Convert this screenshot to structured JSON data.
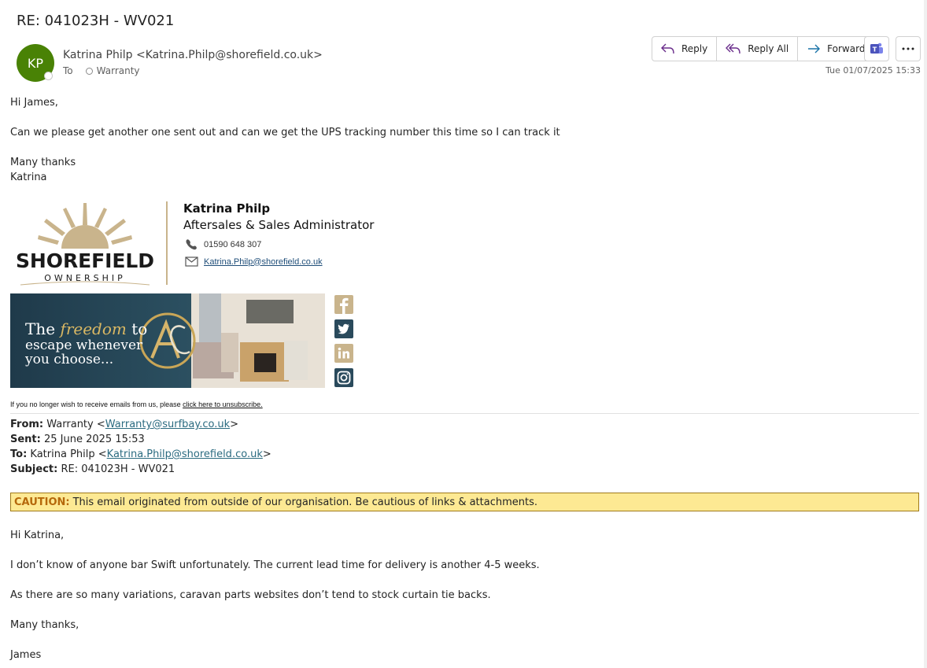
{
  "message": {
    "subject": "RE: 041023H - WV021",
    "avatar_initials": "KP",
    "avatar_color": "#498205",
    "sender": "Katrina Philp <Katrina.Philp@shorefield.co.uk>",
    "to_label": "To",
    "to_recipient": "Warranty",
    "date": "Tue 01/07/2025 15:33"
  },
  "toolbar": {
    "reply_label": "Reply",
    "reply_all_label": "Reply All",
    "forward_label": "Forward",
    "teams_icon": "teams-icon",
    "more_icon": "more-icon"
  },
  "body": {
    "greeting": "Hi James,",
    "line1": "Can we please get another one sent out and can we get the UPS tracking number this time so I can track it",
    "thanks": "Many thanks",
    "name": "Katrina"
  },
  "signature": {
    "logo_text": "SHOREFIELD",
    "logo_subtext": "OWNERSHIP",
    "name": "Katrina Philp",
    "role": "Aftersales & Sales Administrator",
    "phone": "01590 648 307",
    "email": "Katrina.Philp@shorefield.co.uk",
    "banner_line1_a": "The",
    "banner_line1_b": "freedom",
    "banner_line1_c": "to",
    "banner_line2": "escape whenever",
    "banner_line3": "you choose...",
    "social_icons": [
      "facebook-icon",
      "twitter-icon",
      "linkedin-icon",
      "instagram-icon"
    ],
    "unsub_text": "If you no longer wish to receive emails from us, please",
    "unsub_link": "click here to unsubscribe."
  },
  "quoted": {
    "from_label": "From:",
    "from_name": "Warranty <",
    "from_email": "Warranty@surfbay.co.uk",
    "from_close": ">",
    "sent_label": "Sent:",
    "sent_value": "25 June 2025 15:53",
    "to_label": "To:",
    "to_name": "Katrina Philp <",
    "to_email": "Katrina.Philp@shorefield.co.uk",
    "to_close": ">",
    "subject_label": "Subject:",
    "subject_value": "RE: 041023H - WV021"
  },
  "caution": {
    "label": "CAUTION:",
    "text": "This email originated from outside of our organisation. Be cautious of links & attachments."
  },
  "reply_body": {
    "greeting": "Hi Katrina,",
    "line1": "I don’t know of anyone bar Swift unfortunately. The current lead time for delivery is another 4-5 weeks.",
    "line2": "As there are so many variations, caravan parts websites don’t tend to stock curtain tie backs.",
    "thanks": "Many thanks,",
    "name": "James"
  }
}
